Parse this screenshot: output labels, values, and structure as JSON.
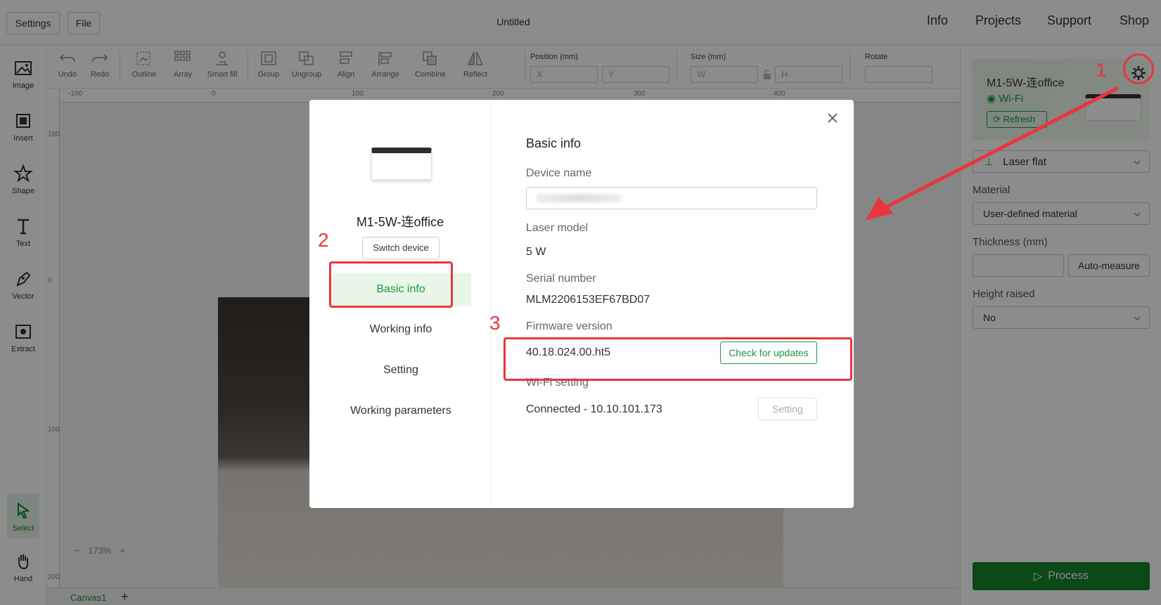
{
  "topbar": {
    "settings": "Settings",
    "file": "File",
    "title": "Untitled",
    "nav": [
      "Info",
      "Projects",
      "Support",
      "Shop"
    ]
  },
  "left_tools": [
    "Image",
    "Insert",
    "Shape",
    "Text",
    "Vector",
    "Extract",
    "Select",
    "Hand"
  ],
  "edit_tools": [
    "Undo",
    "Redo",
    "Outline",
    "Array",
    "Smart fill",
    "Group",
    "Ungroup",
    "Align",
    "Arrange",
    "Combine",
    "Reflect"
  ],
  "fields": {
    "position_label": "Position (mm)",
    "x_placeholder": "X",
    "y_placeholder": "Y",
    "size_label": "Size (mm)",
    "w_placeholder": "W",
    "h_placeholder": "H",
    "rotate_label": "Rotate"
  },
  "rulers": {
    "h": [
      "-100",
      "0",
      "100",
      "200",
      "300",
      "400"
    ],
    "v": [
      "100",
      "0",
      "100",
      "200"
    ]
  },
  "canvas": {
    "zoom": "173%",
    "tab": "Canvas1",
    "add_tab": "+"
  },
  "right_panel": {
    "device_name": "M1-5W-连office",
    "connection": "Wi-Fi",
    "refresh": "Refresh",
    "mode": "Laser flat",
    "material_label": "Material",
    "material_value": "User-defined material",
    "thickness_label": "Thickness (mm)",
    "auto_measure": "Auto-measure",
    "height_label": "Height raised",
    "height_value": "No",
    "process": "Process"
  },
  "modal": {
    "device_name": "M1-5W-连office",
    "switch_device": "Switch device",
    "nav": [
      "Basic info",
      "Working info",
      "Setting",
      "Working parameters"
    ],
    "section_title": "Basic info",
    "device_name_label": "Device name",
    "laser_model_label": "Laser model",
    "laser_model_value": "5 W",
    "serial_label": "Serial number",
    "serial_value": "MLM2206153EF67BD07",
    "firmware_label": "Firmware version",
    "firmware_value": "40.18.024.00.ht5",
    "check_updates": "Check for updates",
    "wifi_label": "Wi-Fi setting",
    "wifi_value": "Connected - 10.10.101.173",
    "wifi_setting_btn": "Setting"
  },
  "annotations": [
    "1",
    "2",
    "3"
  ],
  "colors": {
    "accent": "#1a9a3a",
    "process_bg": "#15862c",
    "annotation": "#e8363c"
  }
}
